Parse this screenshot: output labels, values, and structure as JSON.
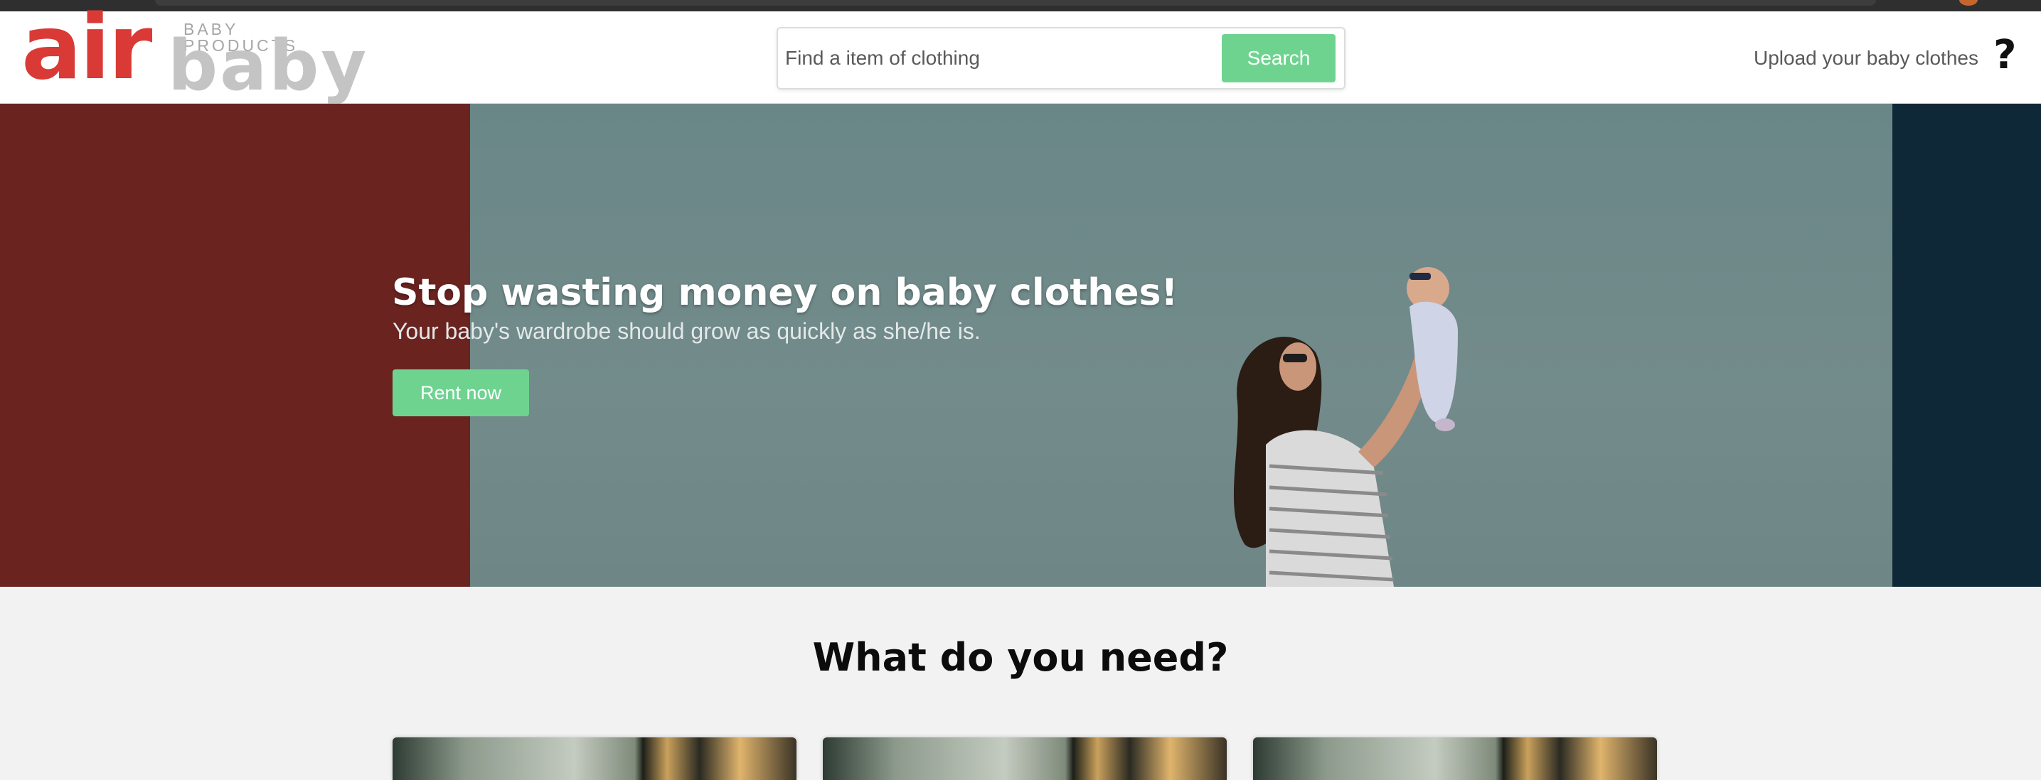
{
  "brand": {
    "logo_primary": "air",
    "logo_secondary": "baby",
    "logo_tagline": "BABY PRODUCTS",
    "primary_color": "#d93a36",
    "accent_color": "#6fd390"
  },
  "header": {
    "search": {
      "placeholder": "Find a item of clothing",
      "value": "",
      "button_label": "Search"
    },
    "upload_link": "Upload your baby clothes",
    "help_icon": "question-mark-icon",
    "help_glyph": "?"
  },
  "hero": {
    "title": "Stop wasting money on baby clothes!",
    "subtitle": "Your baby's wardrobe should grow as quickly as she/he is.",
    "cta_label": "Rent now"
  },
  "categories_section": {
    "title": "What do you need?",
    "cards": [
      {
        "image": "clothing-category-photo"
      },
      {
        "image": "clothing-category-photo"
      },
      {
        "image": "clothing-category-photo"
      }
    ]
  }
}
